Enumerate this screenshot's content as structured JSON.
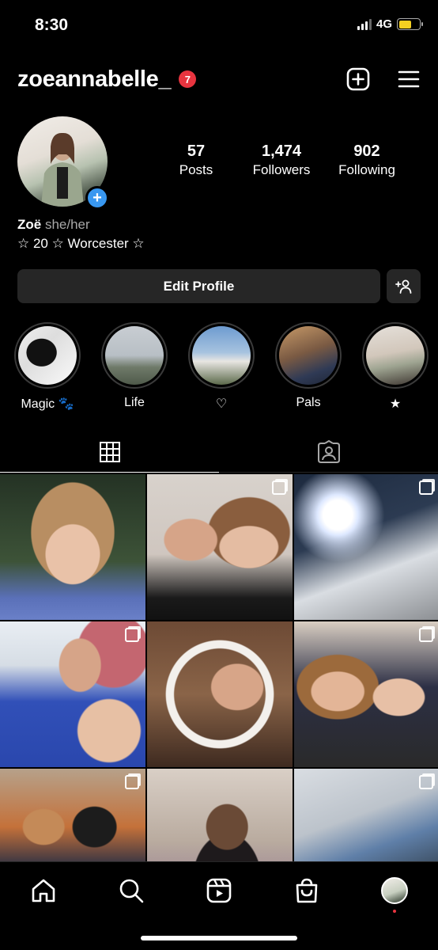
{
  "status_bar": {
    "time": "8:30",
    "network": "4G"
  },
  "header": {
    "username": "zoeannabelle_",
    "notification_count": "7"
  },
  "profile": {
    "stats": [
      {
        "value": "57",
        "label": "Posts"
      },
      {
        "value": "1,474",
        "label": "Followers"
      },
      {
        "value": "902",
        "label": "Following"
      }
    ],
    "name": "Zoë",
    "pronouns": "she/her",
    "bio": "☆ 20 ☆ Worcester ☆",
    "edit_button": "Edit Profile"
  },
  "highlights": [
    {
      "label": "Magic 🐾"
    },
    {
      "label": "Life"
    },
    {
      "label": "♡"
    },
    {
      "label": "Pals"
    },
    {
      "label": "★"
    }
  ],
  "colors": {
    "accent_blue": "#3897f0",
    "badge_red": "#e8343f",
    "button_bg": "#262626"
  },
  "grid_posts": [
    {
      "multi": false
    },
    {
      "multi": true
    },
    {
      "multi": true
    },
    {
      "multi": true
    },
    {
      "multi": false
    },
    {
      "multi": true
    },
    {
      "multi": true
    },
    {
      "multi": false
    },
    {
      "multi": true
    }
  ]
}
